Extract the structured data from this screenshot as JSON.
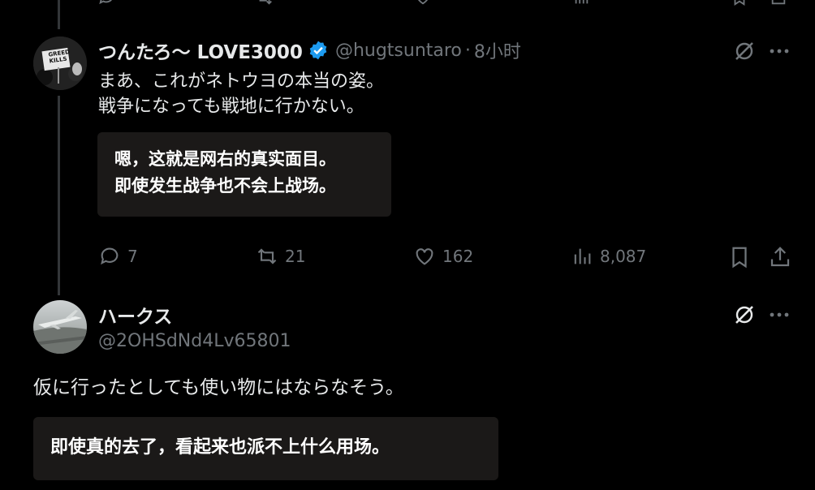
{
  "tweet1": {
    "display_name": "つんたろ〜 LOVE3000",
    "handle": "@hugtsuntaro",
    "separator": "·",
    "time": "8小时",
    "text_line1": "まあ、これがネトウヨの本当の姿。",
    "text_line2": "戦争になっても戦地に行かない。",
    "translation_line1": "嗯，这就是网右的真实面目。",
    "translation_line2": "即使发生战争也不会上战场。",
    "avatar_sign_line1": "GREED",
    "avatar_sign_line2": "KILLS",
    "actions": {
      "replies": "7",
      "reposts": "21",
      "likes": "162",
      "views": "8,087"
    }
  },
  "tweet2": {
    "display_name": "ハークス",
    "handle": "@2OHSdNd4Lv65801",
    "text": "仮に行ったとしても使い物にはならなそう。",
    "translation": "即使真的去了，看起来也派不上什么用场。"
  },
  "colors": {
    "background": "#000000",
    "primary_text": "#e7e9ea",
    "secondary_text": "#71767b",
    "verified_blue": "#1d9bf0",
    "translation_bg": "#1b1918",
    "thread_line": "#333639"
  },
  "icons": [
    "reply-icon",
    "repost-icon",
    "like-icon",
    "views-icon",
    "bookmark-icon",
    "share-icon",
    "grok-icon",
    "more-icon",
    "verified-icon"
  ]
}
